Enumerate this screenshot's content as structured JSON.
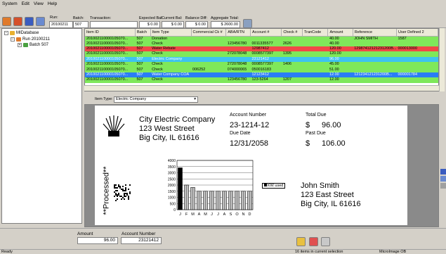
{
  "menu": [
    "System",
    "Edit",
    "View",
    "Help"
  ],
  "header": {
    "run_label": "Run:",
    "run_value": "20100211",
    "batch_label": "Batch:",
    "batch_value": "507",
    "transaction_label": "Transaction:",
    "transaction_value": "",
    "expected_bal_label": "Expected Bal:",
    "expected_bal_value": "$ 0.00",
    "current_bal_label": "Current Bal:",
    "current_bal_value": "$ 0.00",
    "balance_diff_label": "Balance Diff:",
    "balance_diff_value": "$ 0.00",
    "aggregate_total_label": "Aggregate Total:",
    "aggregate_total_value": "$ 2600.00"
  },
  "tree": {
    "root": "MIDatabase",
    "run": "Run 20100211",
    "batch": "Batch 507"
  },
  "grid": {
    "columns": [
      "Item ID",
      "Batch",
      "Item Type",
      "Commercial Ck #",
      "ABA/RTN",
      "Account #",
      "Check #",
      "TranCode",
      "Amount",
      "Reference",
      "User Defined 2"
    ],
    "rows": [
      {
        "id": "201002110000105070...",
        "batch": "507",
        "type": "Donation",
        "comm": "",
        "aba": "",
        "acct": "",
        "check": "",
        "tran": "",
        "amount": "40.00",
        "ref": "JOHN SMITH",
        "ud2": "1587",
        "style": "g"
      },
      {
        "id": "201002110000105070...",
        "batch": "507",
        "type": "Check",
        "comm": "",
        "aba": "123456780",
        "acct": "0011335577",
        "check": "2626",
        "tran": "",
        "amount": "40.00",
        "ref": "",
        "ud2": "",
        "style": "g"
      },
      {
        "id": "201002110000105070...",
        "batch": "507",
        "type": "Water Rebate",
        "comm": "",
        "aba": "",
        "acct": "12987412",
        "check": "",
        "tran": "",
        "amount": "120.00",
        "ref": "12987412121231200B...",
        "ud2": "000013000",
        "style": "r"
      },
      {
        "id": "201002110000105070...",
        "batch": "507",
        "type": "Check",
        "comm": "",
        "aba": "272078048",
        "acct": "0008577397",
        "check": "1395",
        "tran": "",
        "amount": "120.00",
        "ref": "",
        "ud2": "",
        "style": "g"
      },
      {
        "id": "201002110000105070...",
        "batch": "507",
        "type": "Electric Company",
        "comm": "",
        "aba": "",
        "acct": "23121412",
        "check": "",
        "tran": "",
        "amount": "96.00",
        "ref": "",
        "ud2": "",
        "style": "c"
      },
      {
        "id": "201002110000105070...",
        "batch": "507",
        "type": "Check",
        "comm": "",
        "aba": "272078048",
        "acct": "0008577397",
        "check": "1406",
        "tran": "",
        "amount": "45.00",
        "ref": "",
        "ud2": "",
        "style": "g"
      },
      {
        "id": "201002110000105070...",
        "batch": "507",
        "type": "Check",
        "comm": "006252",
        "aba": "074000065",
        "acct": "050016183",
        "check": "",
        "tran": "",
        "amount": "51.00",
        "ref": "",
        "ud2": "",
        "style": "g"
      },
      {
        "id": "201002110000105070...",
        "batch": "507",
        "type": "Water Company COA",
        "comm": "",
        "aba": "",
        "acct": "12123412",
        "check": "",
        "tran": "",
        "amount": "12.00",
        "ref": "121234121231200B...",
        "ud2": "000001784",
        "style": "b"
      },
      {
        "id": "201002110000105070...",
        "batch": "507",
        "type": "Check",
        "comm": "",
        "aba": "123456780",
        "acct": "123-5264",
        "check": "1207",
        "tran": "",
        "amount": "12.00",
        "ref": "",
        "ud2": "",
        "style": "g"
      }
    ]
  },
  "item_type": {
    "label": "Item Type:",
    "value": "Electric Company"
  },
  "coupon": {
    "company_name": "City Electric Company",
    "company_street": "123 West Street",
    "company_city": "Big City, IL 61616",
    "account_number_label": "Account Number",
    "account_number": "23-1214-12",
    "due_date_label": "Due Date",
    "due_date": "12/31/2058",
    "total_due_label": "Total Due",
    "total_due_symbol": "$",
    "total_due": "96.00",
    "past_due_label": "Past Due",
    "past_due_symbol": "$",
    "past_due": "106.00",
    "customer_name": "John Smith",
    "customer_street": "123 East Street",
    "customer_city": "Big City, IL 61616",
    "processed_stamp": "**Processed**",
    "legend": "KW used"
  },
  "chart_data": {
    "type": "bar",
    "categories": [
      "J",
      "F",
      "M",
      "A",
      "M",
      "J",
      "J",
      "A",
      "S",
      "O",
      "N",
      "D"
    ],
    "values": [
      3400,
      2000,
      1800,
      1500,
      1500,
      1500,
      1500,
      1500,
      1500,
      1500,
      1500,
      1500
    ],
    "y_ticks": [
      "4000",
      "3500",
      "3000",
      "2500",
      "2000",
      "1500",
      "1000",
      "500",
      "0"
    ],
    "ylim": [
      0,
      4000
    ],
    "series": [
      {
        "name": "KW used",
        "values": [
          3400,
          2000,
          1800,
          1500,
          1500,
          1500,
          1500,
          1500,
          1500,
          1500,
          1500,
          1500
        ]
      }
    ]
  },
  "bottom": {
    "amount_label": "Amount",
    "amount_value": "96.00",
    "account_label": "Account Number",
    "account_value": "23121412"
  },
  "status": {
    "left": "Ready",
    "center": "16 items in current selection",
    "right": "MicroImage OB"
  },
  "colors": {
    "green_row": "#7fe85a",
    "red_row": "#f04848",
    "cyan_row": "#3ec3f0",
    "blue_row": "#2a7df5"
  }
}
